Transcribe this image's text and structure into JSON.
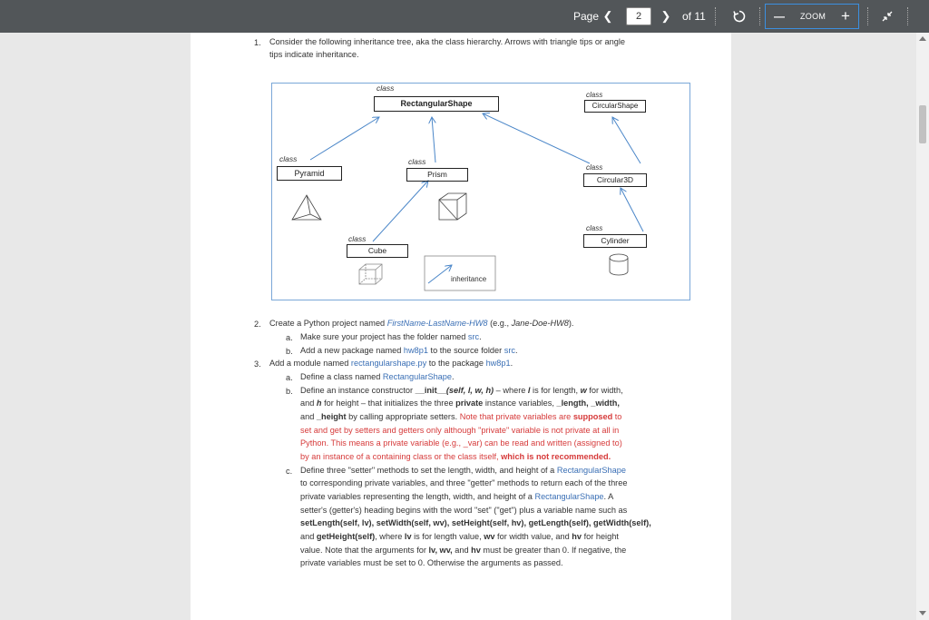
{
  "toolbar": {
    "page_label": "Page",
    "page_value": "2",
    "of_label": "of 11",
    "zoom_label": "ZOOM",
    "minus": "—",
    "plus": "+",
    "prev": "❮",
    "next": "❯"
  },
  "doc": {
    "q1_num": "1.",
    "q1_line1": "Consider the following inheritance tree, aka the class hierarchy. Arrows with triangle tips or angle",
    "q1_line2": "tips indicate inheritance.",
    "diagram": {
      "class_word": "class",
      "rect": "RectangularShape",
      "circ": "CircularShape",
      "pyramid": "Pyramid",
      "prism": "Prism",
      "circ3d": "Circular3D",
      "cube": "Cube",
      "cylinder": "Cylinder",
      "legend": "inheritance"
    },
    "q2_num": "2.",
    "q2_a": "Create a Python project named ",
    "q2_b": "FirstName-LastName-HW8",
    "q2_c": " (e.g., ",
    "q2_d": "Jane-Doe-HW8",
    "q2_e": ").",
    "q2a_letter": "a.",
    "q2a_a": "Make sure your project has the folder named ",
    "q2a_b": "src",
    "q2a_c": ".",
    "q2b_letter": "b.",
    "q2b_a": "Add a new package named ",
    "q2b_b": "hw8p1",
    "q2b_c": " to the source folder ",
    "q2b_d": "src",
    "q2b_e": ".",
    "q3_num": "3.",
    "q3_a": "Add a module named ",
    "q3_b": "rectangularshape.py",
    "q3_c": " to the package ",
    "q3_d": "hw8p1",
    "q3_e": ".",
    "q3a_letter": "a.",
    "q3a_a": "Define a class named ",
    "q3a_b": "RectangularShape",
    "q3a_c": ".",
    "q3b_letter": "b.",
    "q3b_l1a": "Define an instance constructor ",
    "q3b_l1b": "__init__",
    "q3b_l1c": "(self, l, w, h)",
    "q3b_l1d": " – where ",
    "q3b_l1e": "l",
    "q3b_l1f": " is for length, ",
    "q3b_l1g": "w",
    "q3b_l1h": " for width,",
    "q3b_l2a": "and ",
    "q3b_l2b": "h",
    "q3b_l2c": " for height – that initializes the three ",
    "q3b_l2d": "private",
    "q3b_l2e": " instance variables, ",
    "q3b_l2f": "_length, _width,",
    "q3b_l3a": "and ",
    "q3b_l3b": "_height",
    "q3b_l3c": " by calling appropriate setters. ",
    "q3b_l3d": "Note that private variables are ",
    "q3b_l3e": "supposed",
    "q3b_l3f": " to",
    "q3b_l4": "set and get by setters and getters only although \"private\" variable is not private at all in",
    "q3b_l5": "Python. This means a private variable (e.g., _var) can be read and written (assigned to)",
    "q3b_l6a": "by an instance of a containing class or the class itself, ",
    "q3b_l6b": "which is not recommended.",
    "q3c_letter": "c.",
    "q3c_l1a": "Define three \"setter\" methods to set the length, width, and height of a ",
    "q3c_l1b": "RectangularShape",
    "q3c_l2": "to corresponding private variables, and three \"getter\" methods to return each of the three",
    "q3c_l3a": "private variables representing the length, width, and height of a ",
    "q3c_l3b": "RectangularShape",
    "q3c_l3c": ". A",
    "q3c_l4": "setter's (getter's) heading begins with the word \"set\" (\"get\") plus a variable name such as",
    "q3c_l5": "setLength(self, lv), setWidth(self, wv), setHeight(self, hv), getLength(self), getWidth(self),",
    "q3c_l6a": "and ",
    "q3c_l6b": "getHeight(self)",
    "q3c_l6c": ", where ",
    "q3c_l6d": "lv",
    "q3c_l6e": " is for length value, ",
    "q3c_l6f": "wv",
    "q3c_l6g": " for width value, and ",
    "q3c_l6h": "hv",
    "q3c_l6i": " for height",
    "q3c_l7a": "value. Note that the arguments for ",
    "q3c_l7b": "lv, wv,",
    "q3c_l7c": " and ",
    "q3c_l7d": "hv",
    "q3c_l7e": " must be greater than 0. If negative, the",
    "q3c_l8": "private variables must be set to 0. Otherwise the arguments as passed."
  }
}
